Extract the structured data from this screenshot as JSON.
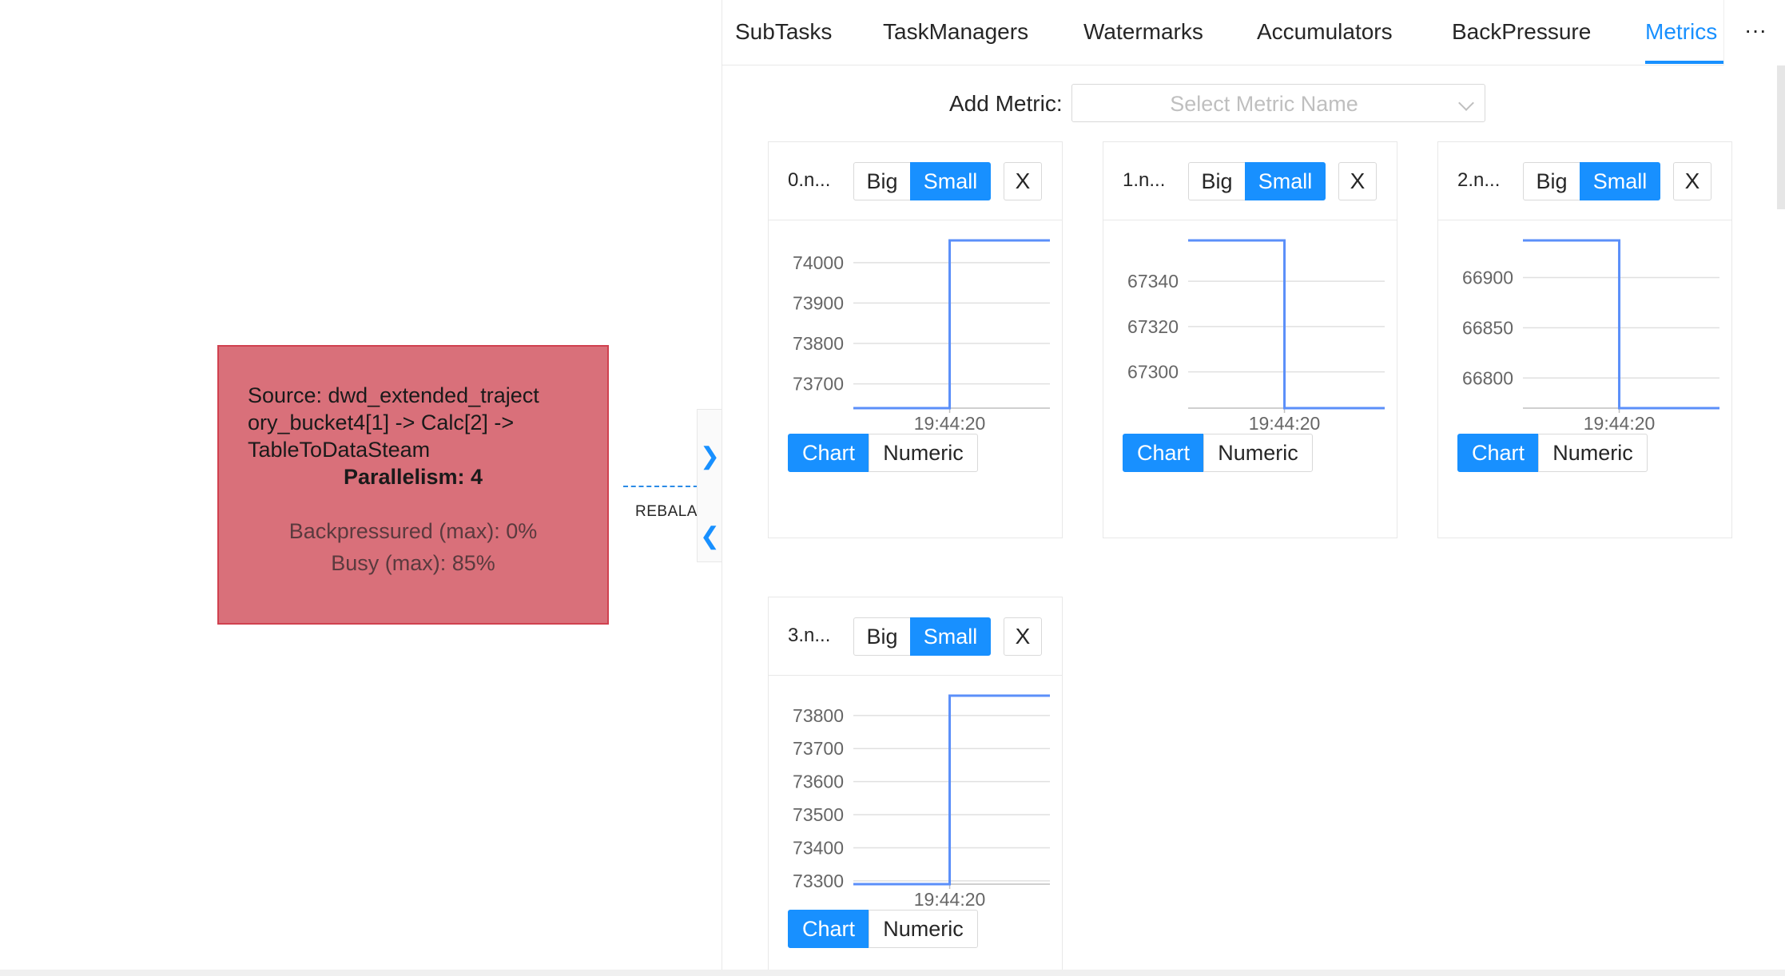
{
  "graph": {
    "node": {
      "source_lines": [
        "Source: dwd_extended_traject",
        "ory_bucket4[1] -> Calc[2] ->",
        "TableToDataSteam"
      ],
      "parallelism": "Parallelism: 4",
      "backpressured": "Backpressured (max): 0%",
      "busy": "Busy (max): 85%",
      "color": "#d9707a"
    },
    "edge_label": "REBALA",
    "expand_icon": "chevron-right-icon",
    "collapse_icon": "chevron-left-icon"
  },
  "tabs": [
    {
      "label": "SubTasks",
      "active": false
    },
    {
      "label": "TaskManagers",
      "active": false
    },
    {
      "label": "Watermarks",
      "active": false
    },
    {
      "label": "Accumulators",
      "active": false
    },
    {
      "label": "BackPressure",
      "active": false
    },
    {
      "label": "Metrics",
      "active": true
    }
  ],
  "tabs_more": "···",
  "add_metric": {
    "label": "Add Metric:",
    "placeholder": "Select Metric Name"
  },
  "card_labels": {
    "big": "Big",
    "small": "Small",
    "close": "X",
    "chart": "Chart",
    "numeric": "Numeric"
  },
  "colors": {
    "accent": "#1890ff",
    "line": "#5b8ff9",
    "node_border": "#d0414f"
  },
  "metrics": [
    {
      "name": "0.n...",
      "size": "Small",
      "view": "Chart",
      "chart_data": {
        "type": "line",
        "x_tick": "19:44:20",
        "y_ticks": [
          73700,
          73800,
          73900,
          74000
        ],
        "ylim": [
          73640,
          74055
        ],
        "points": [
          [
            0,
            73640
          ],
          [
            0.49,
            73640
          ],
          [
            0.49,
            74055
          ],
          [
            1,
            74055
          ]
        ]
      }
    },
    {
      "name": "1.n...",
      "size": "Small",
      "view": "Chart",
      "chart_data": {
        "type": "line",
        "x_tick": "19:44:20",
        "y_ticks": [
          67300,
          67320,
          67340
        ],
        "ylim": [
          67284,
          67358
        ],
        "points": [
          [
            0,
            67358
          ],
          [
            0.49,
            67358
          ],
          [
            0.49,
            67284
          ],
          [
            1,
            67284
          ]
        ]
      }
    },
    {
      "name": "2.n...",
      "size": "Small",
      "view": "Chart",
      "chart_data": {
        "type": "line",
        "x_tick": "19:44:20",
        "y_ticks": [
          66800,
          66850,
          66900
        ],
        "ylim": [
          66770,
          66937
        ],
        "points": [
          [
            0,
            66937
          ],
          [
            0.49,
            66937
          ],
          [
            0.49,
            66770
          ],
          [
            1,
            66770
          ]
        ]
      }
    },
    {
      "name": "3.n...",
      "size": "Small",
      "view": "Chart",
      "chart_data": {
        "type": "line",
        "x_tick": "19:44:20",
        "y_ticks": [
          73300,
          73400,
          73500,
          73600,
          73700,
          73800
        ],
        "ylim": [
          73290,
          73860
        ],
        "points": [
          [
            0,
            73290
          ],
          [
            0.49,
            73290
          ],
          [
            0.49,
            73860
          ],
          [
            1,
            73860
          ]
        ]
      }
    }
  ]
}
